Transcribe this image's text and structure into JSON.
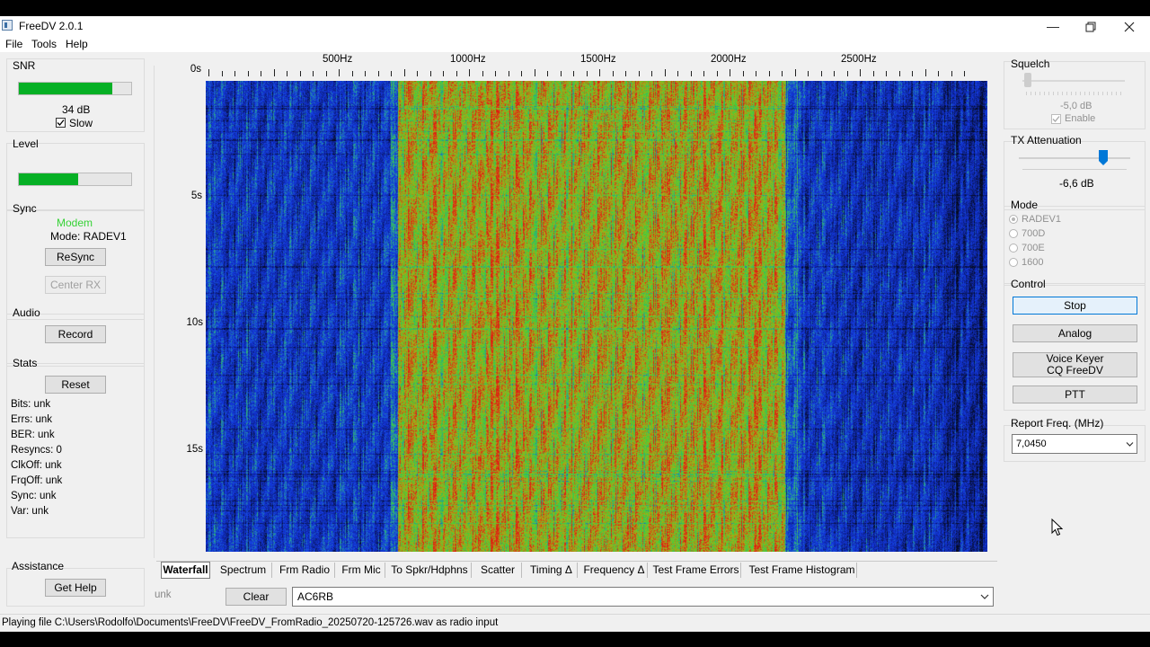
{
  "window": {
    "title": "FreeDV 2.0.1"
  },
  "menu": [
    "File",
    "Tools",
    "Help"
  ],
  "left": {
    "snr": {
      "title": "SNR",
      "value": "34 dB",
      "slow_label": "Slow",
      "slow_checked": true,
      "level_fraction": 0.83
    },
    "level": {
      "title": "Level",
      "level_fraction": 0.53
    },
    "sync": {
      "title": "Sync",
      "status": "Modem",
      "status_color": "#35d235",
      "mode": "Mode: RADEV1",
      "resync_label": "ReSync",
      "center_label": "Center RX"
    },
    "audio": {
      "title": "Audio",
      "record_label": "Record"
    },
    "stats": {
      "title": "Stats",
      "reset_label": "Reset",
      "lines": [
        "Bits: unk",
        "Errs: unk",
        "BER: unk",
        "Resyncs: 0",
        "ClkOff: unk",
        "FrqOff: unk",
        "Sync: unk",
        "Var: unk"
      ]
    },
    "assistance": {
      "title": "Assistance",
      "help_label": "Get Help"
    }
  },
  "waterfall": {
    "freq_labels": [
      "500Hz",
      "1000Hz",
      "1500Hz",
      "2000Hz",
      "2500Hz"
    ],
    "time_labels": [
      "0s",
      "5s",
      "10s",
      "15s"
    ]
  },
  "tabs": [
    "Waterfall",
    "Spectrum",
    "Frm Radio",
    "Frm Mic",
    "To Spkr/Hdphns",
    "Scatter",
    "Timing Δ",
    "Frequency Δ",
    "Test Frame Errors",
    "Test Frame Histogram"
  ],
  "bottom": {
    "unk_label": "unk",
    "clear_label": "Clear",
    "callsign": "AC6RB"
  },
  "right": {
    "squelch": {
      "title": "Squelch",
      "value": "-5,0 dB",
      "enable_label": "Enable",
      "enable_checked": true,
      "slider_fraction": 0.0
    },
    "tx": {
      "title": "TX Attenuation",
      "value": "-6,6 dB",
      "slider_fraction": 0.78
    },
    "mode": {
      "title": "Mode",
      "options": [
        "RADEV1",
        "700D",
        "700E",
        "1600"
      ],
      "selected": "RADEV1"
    },
    "control": {
      "title": "Control",
      "stop_label": "Stop",
      "analog_label": "Analog",
      "keyer_line1": "Voice Keyer",
      "keyer_line2": "CQ FreeDV",
      "ptt_label": "PTT"
    },
    "report": {
      "title": "Report Freq. (MHz)",
      "value": "7,0450"
    }
  },
  "status_text": "Playing file C:\\Users\\Rodolfo\\Documents\\FreeDV\\FreeDV_FromRadio_20250720-125726.wav as radio input"
}
